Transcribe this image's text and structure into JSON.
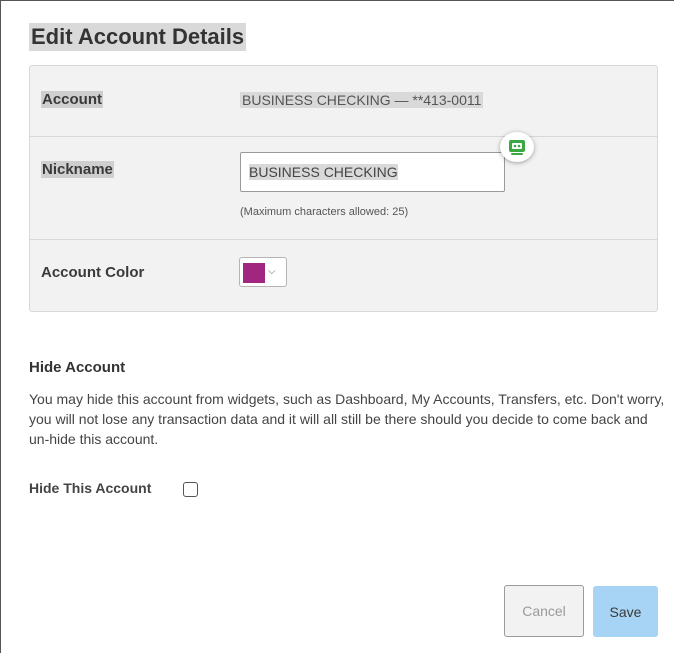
{
  "dialog": {
    "title": "Edit Account Details"
  },
  "details": {
    "account_label": "Account",
    "account_value": "BUSINESS CHECKING — **413-0011",
    "nickname_label": "Nickname",
    "nickname_value": "BUSINESS CHECKING",
    "nickname_helper": "(Maximum characters allowed: 25)",
    "color_label": "Account Color",
    "color_value": "#a0267f",
    "color_chevron": "chevron-down-icon",
    "password_manager_icon": "password-manager-icon",
    "password_manager_color": "#3aa843"
  },
  "hide": {
    "title": "Hide Account",
    "description": "You may hide this account from widgets, such as Dashboard, My Accounts, Transfers, etc. Don't worry, you will not lose any transaction data and it will all still be there should you decide to come back and un-hide this account.",
    "checkbox_label": "Hide This Account",
    "checked": false
  },
  "actions": {
    "cancel_label": "Cancel",
    "save_label": "Save",
    "save_color": "#a7d4f5"
  }
}
